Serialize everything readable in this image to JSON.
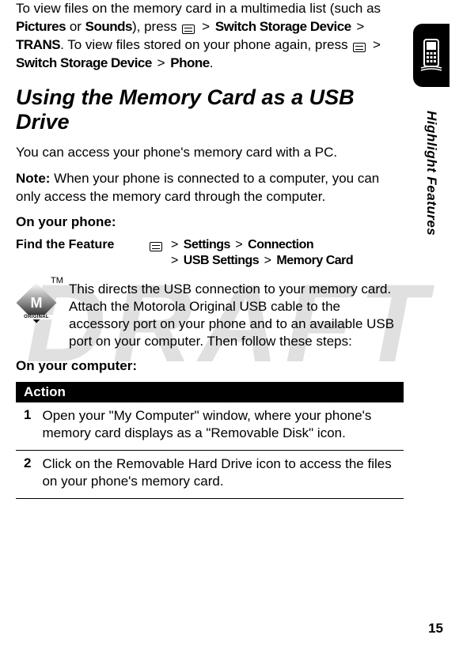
{
  "watermark": "DRAFT",
  "intro": {
    "line1a": "To view files on the memory card in a multimedia list (such as ",
    "pictures": "Pictures",
    "or": " or ",
    "sounds": "Sounds",
    "line1b": "), press ",
    "gt": ">",
    "switch_storage": "Switch Storage Device",
    "trans": "TRANS",
    "line1c": ". To view files stored on your phone again, press ",
    "phone": "Phone",
    "period": "."
  },
  "heading": "Using the Memory Card as a USB Drive",
  "body1": "You can access your phone's memory card with a PC.",
  "note_label": "Note:",
  "note_text": " When your phone is connected to a computer, you can only access the memory card through the computer.",
  "on_phone": "On your phone:",
  "find_feature": {
    "label": "Find the Feature",
    "settings": "Settings",
    "connection": "Connection",
    "usb_settings": "USB Settings",
    "memory_card": "Memory Card"
  },
  "motorola_tag": "ORIGINAL",
  "tm": "TM",
  "motorola_text": "This directs the USB connection to your memory card. Attach the Motorola Original USB cable to the accessory port on your phone and to an available USB port on your computer. Then follow these steps:",
  "on_computer": "On your computer:",
  "action_header": "Action",
  "actions": [
    {
      "num": "1",
      "text": "Open your \"My Computer\" window, where your phone's memory card displays as a \"Removable Disk\" icon."
    },
    {
      "num": "2",
      "text": "Click on the Removable Hard Drive icon to access the files on your phone's memory card."
    }
  ],
  "side_label": "Highlight Features",
  "page_number": "15"
}
